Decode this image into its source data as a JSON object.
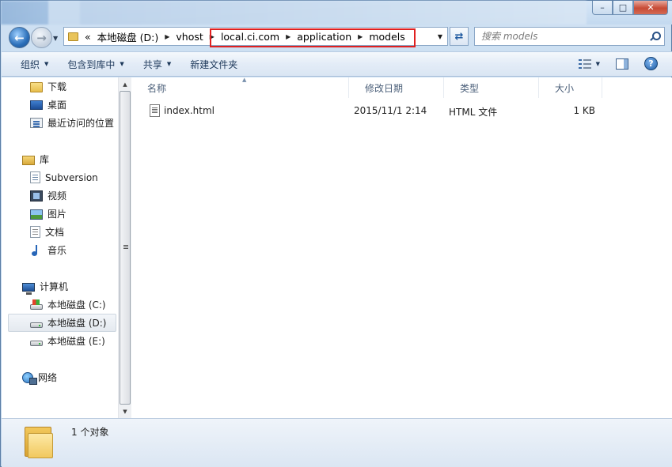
{
  "window": {
    "minimize_glyph": "–",
    "maximize_glyph": "□",
    "close_glyph": "✕"
  },
  "address": {
    "overflow_glyph": "«",
    "crumbs": [
      "本地磁盘 (D:)",
      "vhost",
      "local.ci.com",
      "application",
      "models"
    ]
  },
  "search": {
    "placeholder": "搜索 models"
  },
  "toolbar": {
    "organize": "组织",
    "include_in_library": "包含到库中",
    "share": "共享",
    "new_folder": "新建文件夹",
    "help_glyph": "?"
  },
  "nav": {
    "favorites": [
      "下载",
      "桌面",
      "最近访问的位置"
    ],
    "libraries_label": "库",
    "libraries": [
      "Subversion",
      "视频",
      "图片",
      "文档",
      "音乐"
    ],
    "computer_label": "计算机",
    "drives": [
      "本地磁盘 (C:)",
      "本地磁盘 (D:)",
      "本地磁盘 (E:)"
    ],
    "selected_drive": "本地磁盘 (D:)",
    "network_label": "网络"
  },
  "columns": {
    "name": "名称",
    "modified": "修改日期",
    "type": "类型",
    "size": "大小"
  },
  "files": [
    {
      "name": "index.html",
      "modified": "2015/11/1 2:14",
      "type": "HTML 文件",
      "size": "1 KB"
    }
  ],
  "status": {
    "count_text": "1 个对象"
  },
  "colors": {
    "highlight": "#e02020",
    "accent": "#1e395b"
  }
}
